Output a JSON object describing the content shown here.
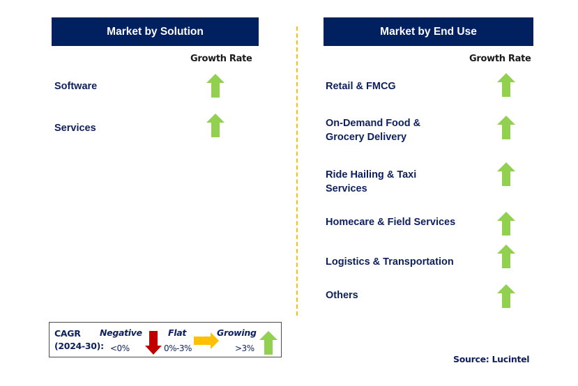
{
  "left_panel": {
    "title": "Market by Solution",
    "growth_header": "Growth Rate",
    "items": [
      {
        "label": "Software",
        "trend": "growing"
      },
      {
        "label": "Services",
        "trend": "growing"
      }
    ]
  },
  "right_panel": {
    "title": "Market by End Use",
    "growth_header": "Growth Rate",
    "items": [
      {
        "label": "Retail & FMCG",
        "trend": "growing"
      },
      {
        "label": "On-Demand Food & Grocery Delivery",
        "trend": "growing"
      },
      {
        "label": "Ride Hailing & Taxi Services",
        "trend": "growing"
      },
      {
        "label": "Homecare & Field Services",
        "trend": "growing"
      },
      {
        "label": "Logistics & Transportation",
        "trend": "growing"
      },
      {
        "label": "Others",
        "trend": "growing"
      }
    ]
  },
  "legend": {
    "cagr_line1": "CAGR",
    "cagr_line2": "(2024-30):",
    "negative": {
      "title": "Negative",
      "range": "<0%",
      "icon": "arrow-down-icon",
      "color": "#c00000"
    },
    "flat": {
      "title": "Flat",
      "range": "0%-3%",
      "icon": "arrow-right-icon",
      "color": "#ffc000"
    },
    "growing": {
      "title": "Growing",
      "range": ">3%",
      "icon": "arrow-up-icon",
      "color": "#92d050"
    }
  },
  "colors": {
    "header_bg": "#002060",
    "label_text": "#0d1f5c",
    "growing": "#92d050",
    "divider": "#ffc000"
  },
  "source": "Source: Lucintel"
}
